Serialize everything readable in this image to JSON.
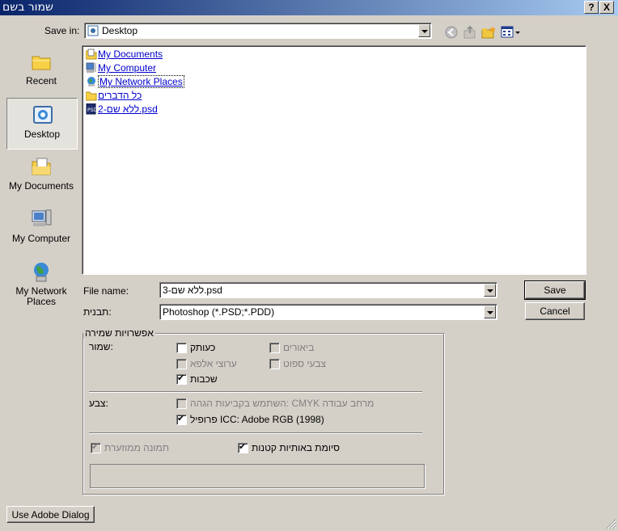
{
  "window": {
    "title": "שמור בשם",
    "help_btn": "?",
    "close_btn": "X"
  },
  "savein": {
    "label": "Save in:",
    "value": "Desktop"
  },
  "places": [
    {
      "label": "Recent",
      "icon": "recent-folder-icon"
    },
    {
      "label": "Desktop",
      "icon": "desktop-icon"
    },
    {
      "label": "My Documents",
      "icon": "my-documents-icon"
    },
    {
      "label": "My Computer",
      "icon": "my-computer-icon"
    },
    {
      "label": "My Network Places",
      "icon": "network-places-icon"
    }
  ],
  "files": [
    {
      "name": "My Documents",
      "icon": "folder-docs-icon"
    },
    {
      "name": "My Computer",
      "icon": "computer-icon"
    },
    {
      "name": "My Network Places",
      "icon": "network-icon"
    },
    {
      "name": "כל הדברים",
      "icon": "folder-icon"
    },
    {
      "name": "ללא שם-2.psd",
      "icon": "psd-file-icon"
    }
  ],
  "filename": {
    "label": "File name:",
    "value": "ללא שם-3.psd"
  },
  "format": {
    "label": "תבנית:",
    "value": "Photoshop (*.PSD;*.PDD)"
  },
  "buttons": {
    "save": "Save",
    "cancel": "Cancel",
    "adobe": "Use Adobe Dialog"
  },
  "options": {
    "legend": "אפשרויות שמירה",
    "save_label": "שמור:",
    "copy": "כעותק",
    "annotations": "ביאורים",
    "alpha": "ערוצי אלפא",
    "spot": "צבעי ספוט",
    "layers": "שכבות",
    "color_label": "צבע:",
    "cmyk": "השתמש בקביעות הגהה: CMYK מרחב עבודה",
    "icc": "פרופיל ICC: Adobe RGB (1998)",
    "thumbnail": "תמונה ממוזערת",
    "lowercase": "סיומת באותיות קטנות",
    "checks": {
      "copy": false,
      "annotations": false,
      "alpha": false,
      "spot": false,
      "layers": true,
      "cmyk": false,
      "icc": true,
      "thumbnail": true,
      "lowercase": true
    }
  }
}
